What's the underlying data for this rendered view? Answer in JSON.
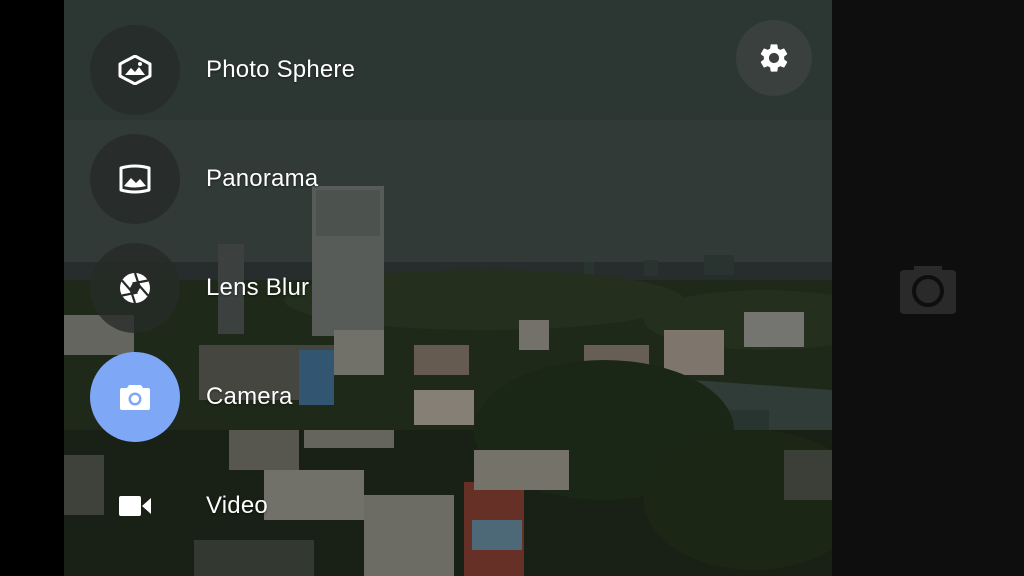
{
  "modes": [
    {
      "label": "Photo Sphere",
      "icon": "photo-sphere-icon"
    },
    {
      "label": "Panorama",
      "icon": "panorama-icon"
    },
    {
      "label": "Lens Blur",
      "icon": "aperture-icon"
    },
    {
      "label": "Camera",
      "icon": "camera-icon",
      "active": true
    },
    {
      "label": "Video",
      "icon": "video-icon"
    }
  ],
  "settings": {
    "icon": "gear-icon"
  },
  "shutter": {
    "icon": "camera-shutter-icon"
  },
  "colors": {
    "active_mode": "#7ea8f6",
    "mode_circle": "#262a28",
    "text": "#ffffff",
    "control_strip": "#0e0e0e"
  }
}
